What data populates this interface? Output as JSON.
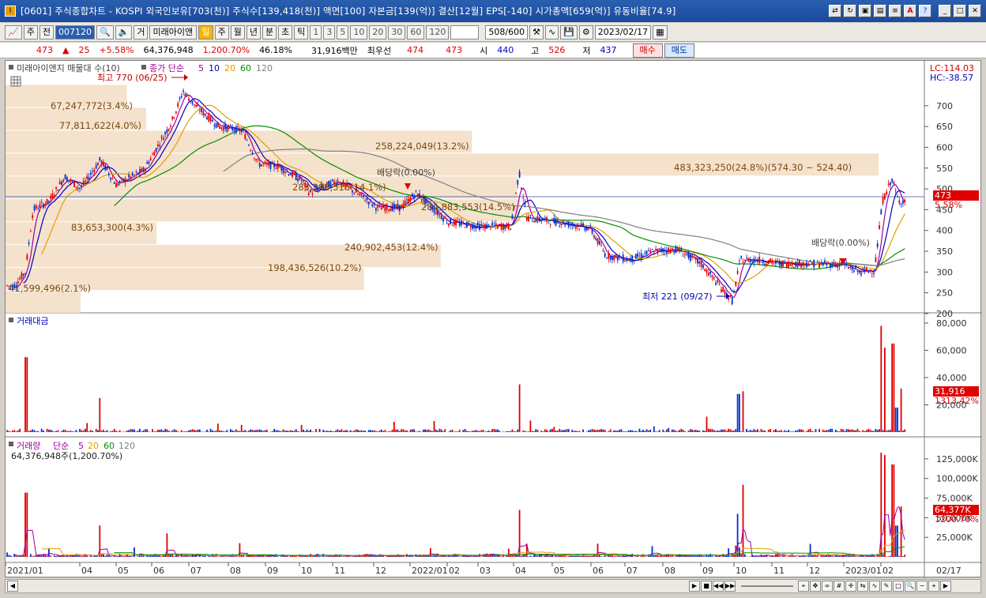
{
  "window": {
    "title": "[0601] 주식종합차트 - KOSPI 외국인보유[703(천)] 주식수[139,418(천)] 액면[100] 자본금[139(억)] 결산[12월] EPS[-140] 시가총액[659(억)] 유동비율[74.9]",
    "app_icon": "I"
  },
  "toolbar": {
    "type_label": "주",
    "prev_label": "전",
    "code": "007120",
    "stock_name": "미래아이앤",
    "gu_label": "거",
    "periods": [
      "일",
      "주",
      "월",
      "년",
      "분",
      "초",
      "틱"
    ],
    "active_period": "일",
    "numbers": [
      "1",
      "3",
      "5",
      "10",
      "20",
      "30",
      "60",
      "120"
    ],
    "count": "508",
    "count_total": "/600",
    "date": "2023/02/17"
  },
  "quote": {
    "price": "473",
    "change_arrow": "▲",
    "change": "25",
    "change_pct": "+5.58%",
    "volume": "64,376,948",
    "volume_pct": "1,200.70%",
    "turnover": "46.18%",
    "amount": "31,916백만",
    "best_label": "최우선",
    "best_ask": "474",
    "best_bid": "473",
    "open_label": "시",
    "open": "440",
    "high_label": "고",
    "high": "526",
    "low_label": "저",
    "low": "437",
    "buy_label": "매수",
    "sell_label": "매도"
  },
  "price_panel": {
    "legend_box": "미래아이앤지 매물대 수(10)",
    "legend_ma": "종가 단순",
    "ma_periods": [
      "5",
      "10",
      "20",
      "60",
      "120"
    ],
    "ma_colors": [
      "#a000a0",
      "#0000c0",
      "#e0a000",
      "#009000",
      "#808080"
    ],
    "lc_label": "LC:114.03",
    "hc_label": "HC:-38.57",
    "last_price": "473",
    "last_pct": "5.58%",
    "high_marker": "최고 770 (06/25)",
    "low_marker": "최저 221 (09/27)",
    "dividend1": "배당락(0.00%)",
    "dividend2": "배당락(0.00%)",
    "profile_labels": [
      "67,247,772(3.4%)",
      "77,811,622(4.0%)",
      "258,224,049(13.2%)",
      "483,323,250(24.8%)(574.30 ~ 524.40)",
      "283,386,510(14.1%)",
      "284,883,553(14.5%)",
      "83,653,300(4.3%)",
      "240,902,453(12.4%)",
      "198,436,526(10.2%)",
      "41,599,496(2.1%)"
    ],
    "y_ticks": [
      "700",
      "650",
      "600",
      "550",
      "500",
      "450",
      "400",
      "350",
      "300",
      "250",
      "200"
    ]
  },
  "amount_panel": {
    "title": "거래대금",
    "last_value": "31,916",
    "last_pct": "1313.42%",
    "y_ticks": [
      "80,000",
      "60,000",
      "40,000",
      "20,000"
    ]
  },
  "volume_panel": {
    "title": "거래량",
    "legend_ma": "단순",
    "ma_periods": [
      "5",
      "20",
      "60",
      "120"
    ],
    "current": "64,376,948주(1,200.70%)",
    "last_value": "64,377K",
    "last_pct": "1200.70%",
    "y_ticks": [
      "125,000K",
      "100,000K",
      "75,000K",
      "50,000K",
      "25,000K"
    ]
  },
  "x_axis": {
    "labels": [
      "2021/01",
      "04",
      "05",
      "06",
      "07",
      "08",
      "09",
      "10",
      "11",
      "12",
      "2022/01",
      "02",
      "03",
      "04",
      "05",
      "06",
      "07",
      "08",
      "09",
      "10",
      "11",
      "12",
      "2023/01",
      "02"
    ],
    "right_label": "02/17"
  },
  "chart_data": {
    "type": "candlestick",
    "price_range": [
      200,
      750
    ],
    "profile_volumes": [
      41599496,
      198436526,
      240902453,
      83653300,
      284883553,
      283386510,
      483323250,
      258224049,
      77811622,
      67247772
    ],
    "ma_periods": [
      5,
      10,
      20,
      60,
      120
    ],
    "last_close": 473,
    "high": 770,
    "low": 221
  }
}
